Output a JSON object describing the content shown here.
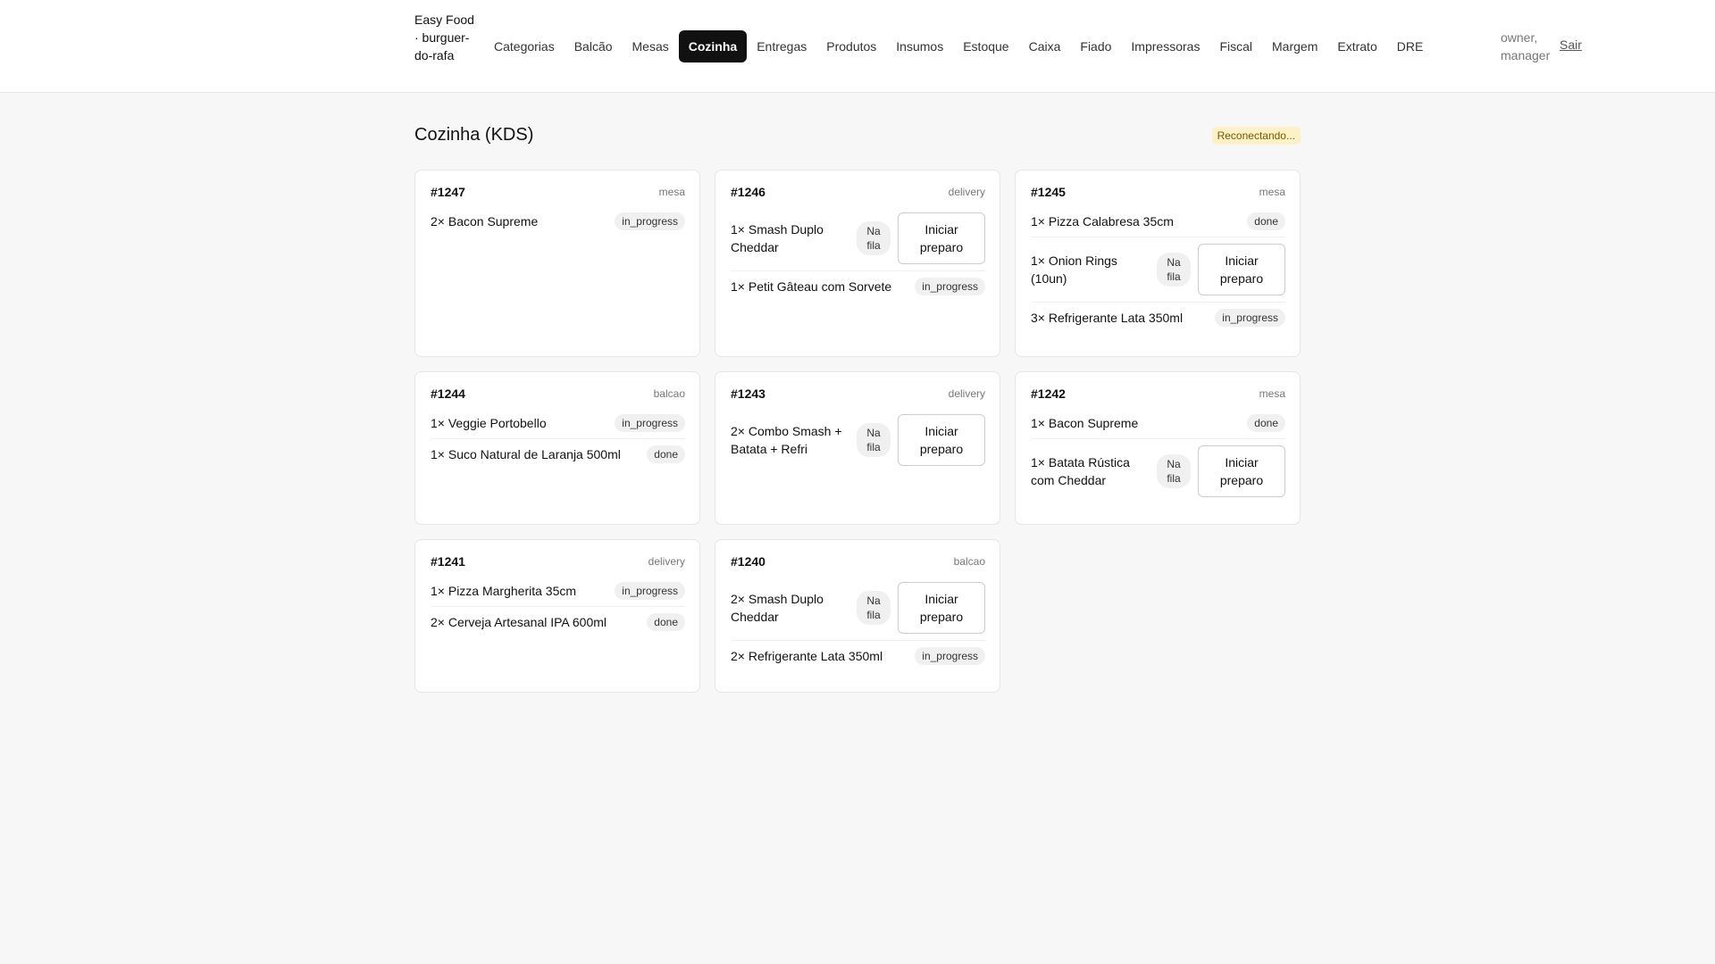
{
  "brand": "Easy Food · burguer-do-rafa",
  "nav": [
    "Categorias",
    "Balcão",
    "Mesas",
    "Cozinha",
    "Entregas",
    "Produtos",
    "Insumos",
    "Estoque",
    "Caixa",
    "Fiado",
    "Impressoras",
    "Fiscal",
    "Margem",
    "Extrato",
    "DRE"
  ],
  "active_nav": "Cozinha",
  "user_roles": "owner, manager",
  "logout_label": "Sair",
  "page_title": "Cozinha (KDS)",
  "connection_status": "Reconectando...",
  "labels": {
    "queue": "Na fila",
    "start_button": "Iniciar preparo"
  },
  "orders": [
    {
      "number": "#1247",
      "type": "mesa",
      "items": [
        {
          "text": "2× Bacon Supreme",
          "status": "in_progress"
        }
      ]
    },
    {
      "number": "#1246",
      "type": "delivery",
      "items": [
        {
          "text": "1× Smash Duplo Cheddar",
          "status": "queued"
        },
        {
          "text": "1× Petit Gâteau com Sorvete",
          "status": "in_progress"
        }
      ]
    },
    {
      "number": "#1245",
      "type": "mesa",
      "items": [
        {
          "text": "1× Pizza Calabresa 35cm",
          "status": "done"
        },
        {
          "text": "1× Onion Rings (10un)",
          "status": "queued"
        },
        {
          "text": "3× Refrigerante Lata 350ml",
          "status": "in_progress"
        }
      ]
    },
    {
      "number": "#1244",
      "type": "balcao",
      "items": [
        {
          "text": "1× Veggie Portobello",
          "status": "in_progress"
        },
        {
          "text": "1× Suco Natural de Laranja 500ml",
          "status": "done"
        }
      ]
    },
    {
      "number": "#1243",
      "type": "delivery",
      "items": [
        {
          "text": "2× Combo Smash + Batata + Refri",
          "status": "queued"
        }
      ]
    },
    {
      "number": "#1242",
      "type": "mesa",
      "items": [
        {
          "text": "1× Bacon Supreme",
          "status": "done"
        },
        {
          "text": "1× Batata Rústica com Cheddar",
          "status": "queued"
        }
      ]
    },
    {
      "number": "#1241",
      "type": "delivery",
      "items": [
        {
          "text": "1× Pizza Margherita 35cm",
          "status": "in_progress"
        },
        {
          "text": "2× Cerveja Artesanal IPA 600ml",
          "status": "done"
        }
      ]
    },
    {
      "number": "#1240",
      "type": "balcao",
      "items": [
        {
          "text": "2× Smash Duplo Cheddar",
          "status": "queued"
        },
        {
          "text": "2× Refrigerante Lata 350ml",
          "status": "in_progress"
        }
      ]
    }
  ]
}
